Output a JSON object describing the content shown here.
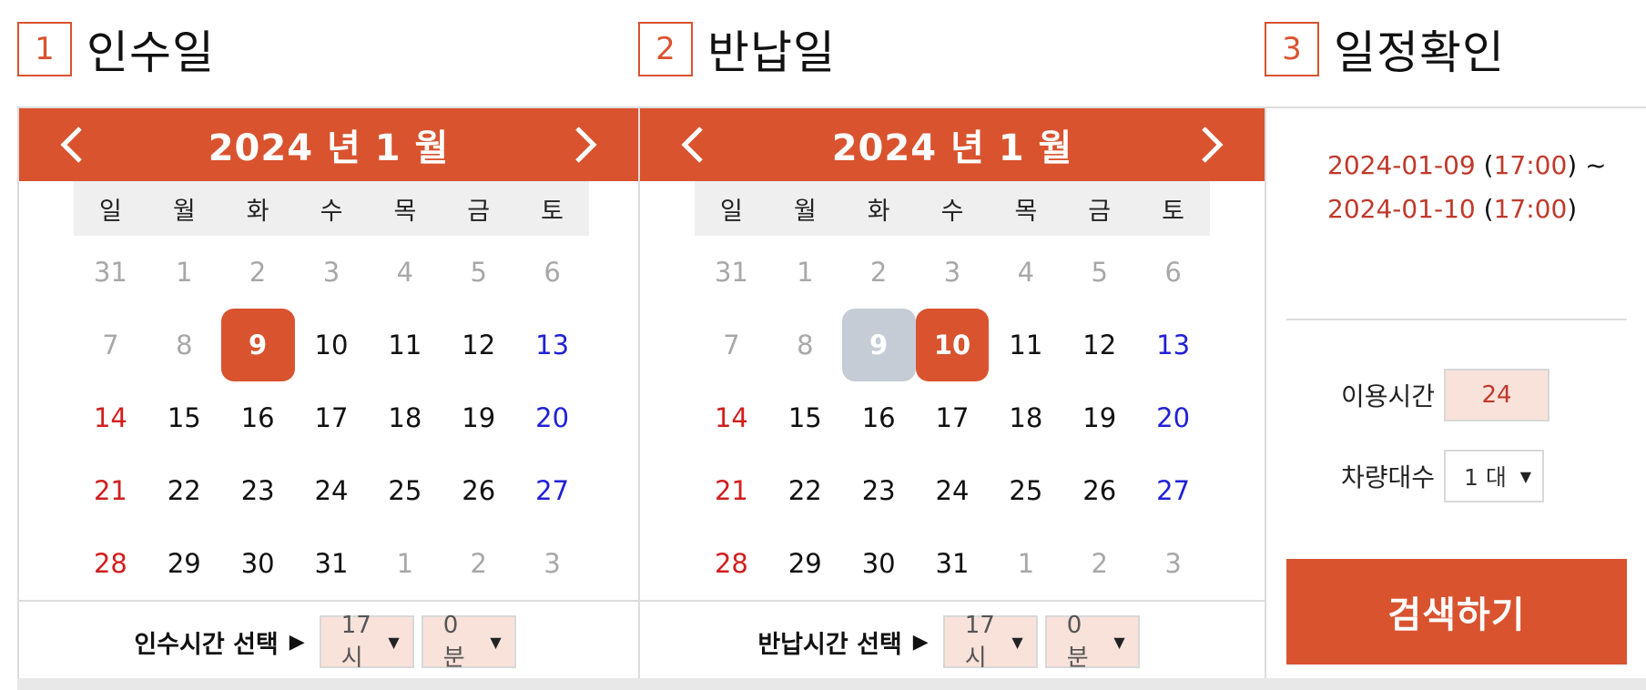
{
  "steps": [
    {
      "num": "1",
      "title": "인수일"
    },
    {
      "num": "2",
      "title": "반납일"
    },
    {
      "num": "3",
      "title": "일정확인"
    }
  ],
  "weekdays": [
    "일",
    "월",
    "화",
    "수",
    "목",
    "금",
    "토"
  ],
  "colors": {
    "accent": "#d9532f",
    "range": "#c5ccd6",
    "sunday": "#d21e1e",
    "saturday": "#2121d6",
    "muted": "#a8a8a8"
  },
  "pickup": {
    "month_title": "2024 년 1 월",
    "weeks": [
      [
        "31",
        "1",
        "2",
        "3",
        "4",
        "5",
        "6"
      ],
      [
        "7",
        "8",
        "9",
        "10",
        "11",
        "12",
        "13"
      ],
      [
        "14",
        "15",
        "16",
        "17",
        "18",
        "19",
        "20"
      ],
      [
        "21",
        "22",
        "23",
        "24",
        "25",
        "26",
        "27"
      ],
      [
        "28",
        "29",
        "30",
        "31",
        "1",
        "2",
        "3"
      ]
    ],
    "selected_day": "9",
    "time_label": "인수시간 선택",
    "hour": "17시",
    "minute": "0분"
  },
  "return": {
    "month_title": "2024 년 1 월",
    "weeks": [
      [
        "31",
        "1",
        "2",
        "3",
        "4",
        "5",
        "6"
      ],
      [
        "7",
        "8",
        "9",
        "10",
        "11",
        "12",
        "13"
      ],
      [
        "14",
        "15",
        "16",
        "17",
        "18",
        "19",
        "20"
      ],
      [
        "21",
        "22",
        "23",
        "24",
        "25",
        "26",
        "27"
      ],
      [
        "28",
        "29",
        "30",
        "31",
        "1",
        "2",
        "3"
      ]
    ],
    "range_day": "9",
    "selected_day": "10",
    "time_label": "반납시간 선택",
    "hour": "17시",
    "minute": "0분"
  },
  "confirm": {
    "start_date": "2024-01-09",
    "start_time": "17:00",
    "tilde": "~",
    "end_date": "2024-01-10",
    "end_time": "17:00",
    "usage_label": "이용시간",
    "usage_value": "24",
    "cars_label": "차량대수",
    "cars_value": "1 대",
    "search_label": "검색하기"
  }
}
